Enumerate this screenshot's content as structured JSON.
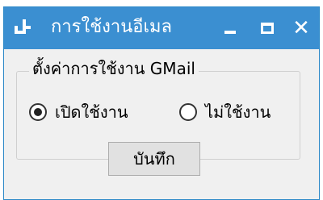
{
  "window": {
    "title": "การใช้งานอีเมล",
    "icon": "app-window-icon",
    "controls": {
      "minimize": "minimize-icon",
      "maximize": "maximize-icon",
      "close": "close-icon"
    }
  },
  "group": {
    "legend": "ตั้งค่าการใช้งาน GMail",
    "options": [
      {
        "label": "เปิดใช้งาน",
        "selected": true
      },
      {
        "label": "ไม่ใช้งาน",
        "selected": false
      }
    ]
  },
  "actions": {
    "save_label": "บันทึก"
  },
  "colors": {
    "titlebar": "#3b8fd1",
    "window_bg": "#f0f0f0",
    "button_bg": "#e1e1e1"
  }
}
